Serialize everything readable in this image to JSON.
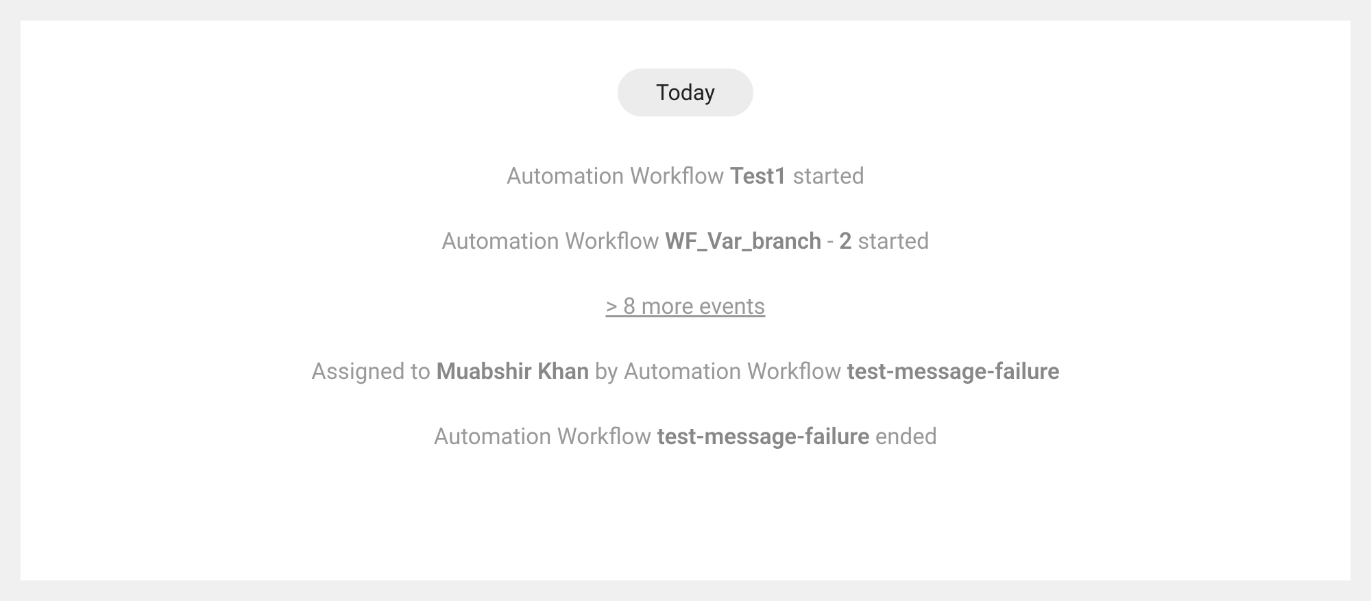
{
  "dateBadge": "Today",
  "events": {
    "line1": {
      "prefix": "Automation Workflow ",
      "bold": "Test1",
      "suffix": " started"
    },
    "line2": {
      "prefix": "Automation Workflow ",
      "bold1": "WF_Var_branch",
      "mid": " - ",
      "bold2": "2",
      "suffix": " started"
    },
    "moreEvents": "> 8 more events",
    "line3": {
      "prefix": "Assigned to ",
      "bold1": "Muabshir Khan",
      "mid": " by Automation Workflow ",
      "bold2": "test-message-failure"
    },
    "line4": {
      "prefix": "Automation Workflow ",
      "bold": "test-message-failure",
      "suffix": " ended"
    }
  }
}
